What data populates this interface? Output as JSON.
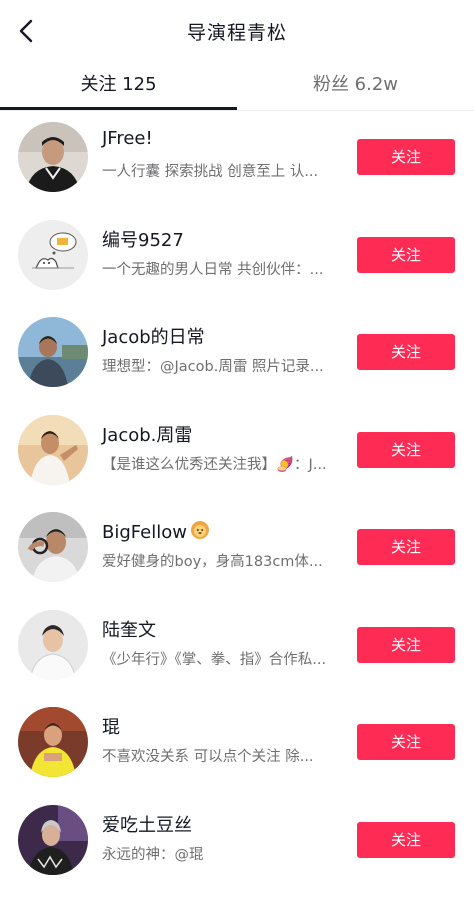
{
  "header": {
    "title": "导演程青松",
    "back_icon": "chevron-left-icon"
  },
  "tabs": [
    {
      "label": "关注 125",
      "active": true
    },
    {
      "label": "粉丝 6.2w",
      "active": false
    }
  ],
  "colors": {
    "accent": "#fe2c55",
    "text_primary": "#161823",
    "text_secondary": "#6f6f72"
  },
  "users": [
    {
      "name": "JFree!",
      "bio": "一人行囊 探索挑战 创意至上 认...",
      "button": "关注"
    },
    {
      "name": "编号9527",
      "bio": "一个无趣的男人日常 共创伙伴：...",
      "button": "关注"
    },
    {
      "name": "Jacob的日常",
      "bio": "理想型：@Jacob.周雷 照片记录...",
      "button": "关注"
    },
    {
      "name": "Jacob.周雷",
      "bio": "【是谁这么优秀还关注我】🍠：J...",
      "button": "关注"
    },
    {
      "name": "BigFellow",
      "name_emoji": "lion-face-emoji",
      "bio": "爱好健身的boy，身高183cm体...",
      "button": "关注"
    },
    {
      "name": "陆奎文",
      "bio": "《少年行》《掌、拳、指》合作私...",
      "button": "关注"
    },
    {
      "name": "琨",
      "bio": "不喜欢没关系 可以点个关注 除...",
      "button": "关注"
    },
    {
      "name": "爱吃土豆丝",
      "bio": "永远的神：@琨",
      "button": "关注"
    }
  ]
}
